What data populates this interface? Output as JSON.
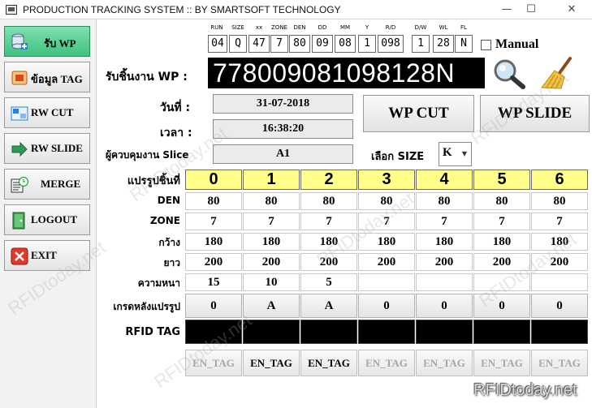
{
  "window": {
    "title": "PRODUCTION TRACKING SYSTEM :: BY SMARTSOFT TECHNOLOGY",
    "minimize": "—",
    "maximize": "☐",
    "close": "✕"
  },
  "sidebar": {
    "items": [
      {
        "label": "รับ WP",
        "icon": "database-add-icon",
        "active": true
      },
      {
        "label": "ข้อมูล TAG",
        "icon": "tag-info-icon",
        "active": false
      },
      {
        "label": "RW CUT",
        "icon": "cut-icon",
        "active": false
      },
      {
        "label": "RW SLIDE",
        "icon": "slide-arrow-icon",
        "active": false
      },
      {
        "label": "MERGE",
        "icon": "merge-clock-icon",
        "active": false
      },
      {
        "label": "LOGOUT",
        "icon": "logout-door-icon",
        "active": false
      },
      {
        "label": "EXIT",
        "icon": "exit-icon",
        "active": false
      }
    ]
  },
  "code_fields": [
    {
      "header": "RUN",
      "value": "04"
    },
    {
      "header": "SIZE",
      "value": "Q"
    },
    {
      "header": "xx",
      "value": "47"
    },
    {
      "header": "ZONE",
      "value": "7"
    },
    {
      "header": "DEN",
      "value": "80"
    },
    {
      "header": "DD",
      "value": "09"
    },
    {
      "header": "MM",
      "value": "08"
    },
    {
      "header": "Y",
      "value": "1"
    },
    {
      "header": "R/D",
      "value": "098"
    },
    {
      "header": "D/W",
      "value": "1"
    },
    {
      "header": "WL",
      "value": "28"
    },
    {
      "header": "FL",
      "value": "N"
    }
  ],
  "manual": {
    "label": "Manual",
    "checked": false
  },
  "receive_wp": {
    "label": "รับชิ้นงาน WP :",
    "value": "778009081098128N"
  },
  "date": {
    "label": "วันที่ :",
    "value": "31-07-2018"
  },
  "time": {
    "label": "เวลา :",
    "value": "16:38:20"
  },
  "supervisor": {
    "label": "ผู้ควบคุมงาน  Slice",
    "value": "A1"
  },
  "size_select": {
    "label": "เลือก SIZE",
    "value": "K"
  },
  "buttons": {
    "wp_cut": "WP CUT",
    "wp_slide": "WP SLIDE"
  },
  "grid": {
    "header_label": "แปรรูปชิ้นที่",
    "columns": [
      "0",
      "1",
      "2",
      "3",
      "4",
      "5",
      "6"
    ],
    "rows": [
      {
        "label": "DEN",
        "values": [
          "80",
          "80",
          "80",
          "80",
          "80",
          "80",
          "80"
        ]
      },
      {
        "label": "ZONE",
        "values": [
          "7",
          "7",
          "7",
          "7",
          "7",
          "7",
          "7"
        ]
      },
      {
        "label": "กว้าง",
        "values": [
          "180",
          "180",
          "180",
          "180",
          "180",
          "180",
          "180"
        ]
      },
      {
        "label": "ยาว",
        "values": [
          "200",
          "200",
          "200",
          "200",
          "200",
          "200",
          "200"
        ]
      },
      {
        "label": "ความหนา",
        "values": [
          "15",
          "10",
          "5",
          "",
          "",
          "",
          ""
        ]
      }
    ],
    "grade_label": "เกรดหลังแปรรูป",
    "grades": [
      "0",
      "A",
      "A",
      "0",
      "0",
      "0",
      "0"
    ],
    "rfid_label": "RFID TAG",
    "en_tag_label": "EN_TAG",
    "en_tag_enabled": [
      false,
      true,
      true,
      false,
      false,
      false,
      false
    ]
  },
  "watermark": {
    "text": "RFIDtoday.net",
    "brand": "RFIDtoday.net"
  },
  "colors": {
    "active_green": "#3fc17e",
    "header_yellow": "#ffff8a",
    "display_black": "#000000"
  }
}
